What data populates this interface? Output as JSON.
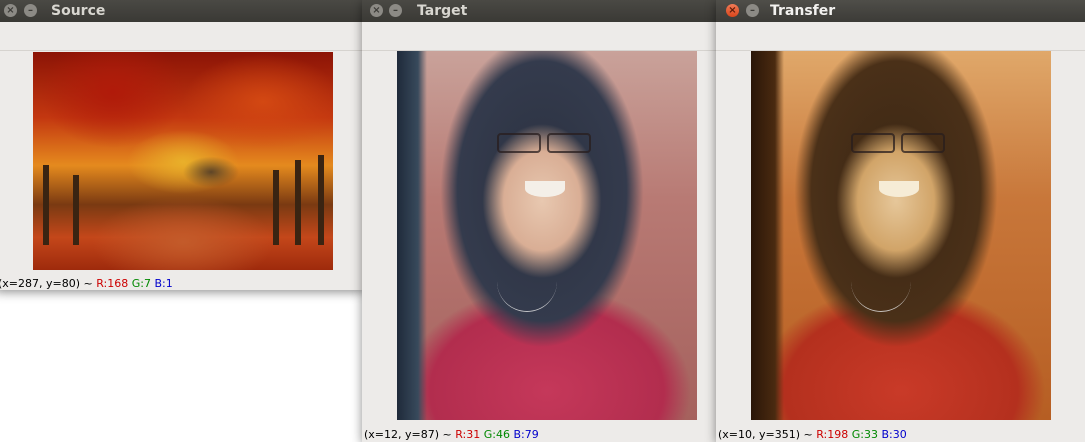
{
  "windows": {
    "source": {
      "title": "Source",
      "status": {
        "coords": "(x=287, y=80) ~ ",
        "r": "R:168",
        "g": "G:7",
        "b": "B:1"
      }
    },
    "target": {
      "title": "Target",
      "status": {
        "coords": "(x=12, y=87) ~ ",
        "r": "R:31",
        "g": "G:46",
        "b": "B:79"
      }
    },
    "transfer": {
      "title": "Transfer",
      "status": {
        "coords": "(x=10, y=351) ~ ",
        "r": "R:198",
        "g": "G:33",
        "b": "B:30"
      }
    }
  },
  "buttons": {
    "close_glyph": "×",
    "minimize_glyph": "–"
  },
  "colors": {
    "titlebar": "#3c3b37",
    "close_active": "#e0592b",
    "window_bg": "#edebe9"
  }
}
